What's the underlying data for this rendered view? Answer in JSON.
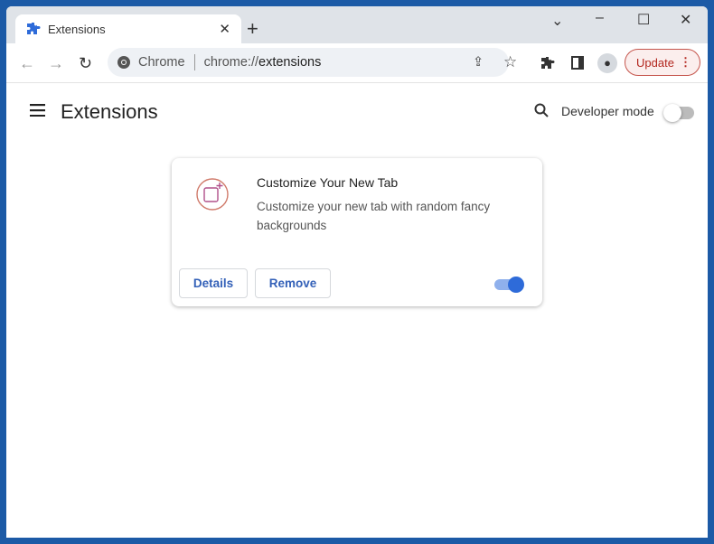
{
  "tab": {
    "title": "Extensions"
  },
  "toolbar": {
    "origin_label": "Chrome",
    "url_prefix": "chrome://",
    "url_path": "extensions",
    "update_label": "Update"
  },
  "page": {
    "title": "Extensions",
    "developer_mode_label": "Developer mode",
    "developer_mode_on": false
  },
  "extension": {
    "name": "Customize Your New Tab",
    "description": "Customize your new tab with random fancy backgrounds",
    "details_label": "Details",
    "remove_label": "Remove",
    "enabled": true
  },
  "colors": {
    "accent": "#2e6bd9",
    "update": "#b3261e",
    "frame": "#1c5aa6"
  }
}
